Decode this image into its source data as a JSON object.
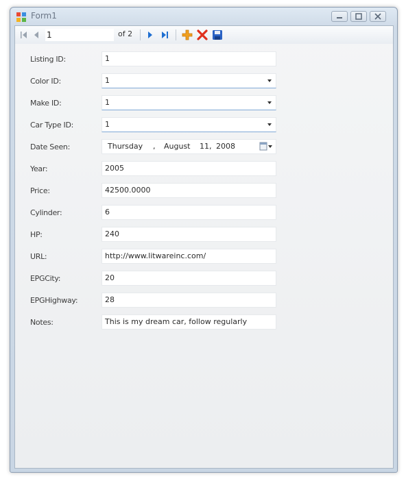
{
  "window": {
    "title": "Form1"
  },
  "navigator": {
    "position": "1",
    "count_label": "of 2"
  },
  "form": {
    "fields": [
      {
        "label": "Listing ID:",
        "value": "1",
        "type": "text"
      },
      {
        "label": "Color ID:",
        "value": "1",
        "type": "combo"
      },
      {
        "label": "Make ID:",
        "value": "1",
        "type": "combo"
      },
      {
        "label": "Car Type ID:",
        "value": "1",
        "type": "combo"
      },
      {
        "label": "Date Seen:",
        "type": "date"
      },
      {
        "label": "Year:",
        "value": "2005",
        "type": "text"
      },
      {
        "label": "Price:",
        "value": "42500.0000",
        "type": "text"
      },
      {
        "label": "Cylinder:",
        "value": "6",
        "type": "text"
      },
      {
        "label": "HP:",
        "value": "240",
        "type": "text"
      },
      {
        "label": "URL:",
        "value": "http://www.litwareinc.com/",
        "type": "text"
      },
      {
        "label": "EPGCity:",
        "value": "20",
        "type": "text"
      },
      {
        "label": "EPGHighway:",
        "value": "28",
        "type": "text"
      },
      {
        "label": "Notes:",
        "value": "This is my dream car, follow regularly",
        "type": "text"
      }
    ],
    "date": {
      "weekday": "Thursday",
      "sep": ",",
      "month": "August",
      "day": "11,",
      "year": "2008"
    }
  },
  "colors": {
    "nav_blue": "#1f6fd1",
    "delete_red": "#e0301e",
    "add_orange": "#f0a020",
    "save_blue": "#2a62c4"
  }
}
